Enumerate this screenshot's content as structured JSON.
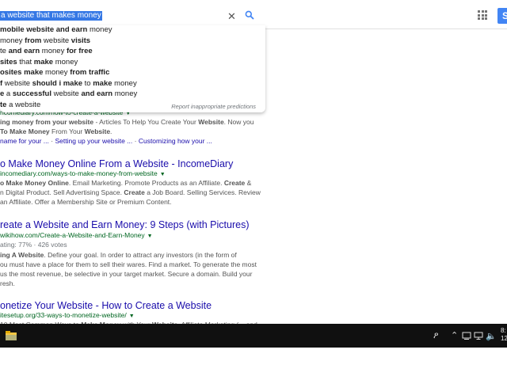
{
  "search": {
    "query": "a website that makes money",
    "clear_icon": "close-icon",
    "search_icon": "search-icon"
  },
  "header": {
    "apps_icon": "apps-grid-icon",
    "signin_label": "S"
  },
  "suggestions": [
    [
      "",
      "mobile website and earn",
      " money"
    ],
    [
      " money ",
      "from",
      " website ",
      "visits"
    ],
    [
      "te ",
      "and earn",
      " money ",
      "for free"
    ],
    [
      "sites",
      " that ",
      "make",
      " money"
    ],
    [
      "osites make",
      " money ",
      "from traffic"
    ],
    [
      "f",
      " website ",
      "should i make",
      " to ",
      "make",
      " money"
    ],
    [
      "e",
      " a ",
      "successful",
      " website ",
      "and earn",
      " money"
    ],
    [
      "te",
      " a website"
    ]
  ],
  "report_label": "Report inappropriate predictions",
  "results": [
    {
      "url": "ncomediary.com/how-to-create-a-website",
      "snippet_lines": [
        [
          "ing money from your website",
          " - Articles To Help You Create Your ",
          "Website",
          ". Now you"
        ],
        [
          "To Make Money",
          " From Your ",
          "Website",
          "."
        ]
      ],
      "sitelinks": [
        "name for your ...",
        "Setting up your website ...",
        "Customizing how your ..."
      ]
    },
    {
      "title": "o Make Money Online From a Website - IncomeDiary",
      "url": "incomediary.com/ways-to-make-money-from-website",
      "snippet_lines": [
        [
          "o Make Money Online",
          ". Email Marketing. Promote Products as an Affiliate. ",
          "Create",
          " &"
        ],
        [
          "n Digital Product. Sell Advertising Space. ",
          "Create",
          " a Job Board. Selling Services. Review"
        ],
        [
          "an Affiliate. Offer a Membership Site or Premium Content."
        ]
      ]
    },
    {
      "title": "reate a Website and Earn Money: 9 Steps (with Pictures)",
      "url": "wikihow.com/Create-a-Website-and-Earn-Money",
      "rating": "ating: 77% · 426 votes",
      "snippet_lines": [
        [
          "ing A Website",
          ". Define your goal. In order to attract any investors (in the form of"
        ],
        [
          "ou must have a place for them to sell their wares. Find a market. To generate the most"
        ],
        [
          "us the most revenue, be selective in your target market. Secure a domain. Build your"
        ],
        [
          "resh."
        ]
      ]
    },
    {
      "title": "onetize Your Website - How to Create a Website",
      "url": "itesetup.org/33-ways-to-monetize-website/",
      "snippet_lines": [
        [
          "10 Most Common Ways to ",
          "Make Money",
          " with Your ",
          "Website",
          ". Affiliate Marketing (... and"
        ]
      ]
    }
  ],
  "taskbar": {
    "folder_icon": "file-explorer-icon",
    "people_icon": "people-icon",
    "chevron_icon": "chevron-up-icon",
    "network_icon": "network-icon",
    "display_icon": "display-icon",
    "volume_icon": "volume-icon",
    "time": "8:",
    "date": "12/"
  }
}
